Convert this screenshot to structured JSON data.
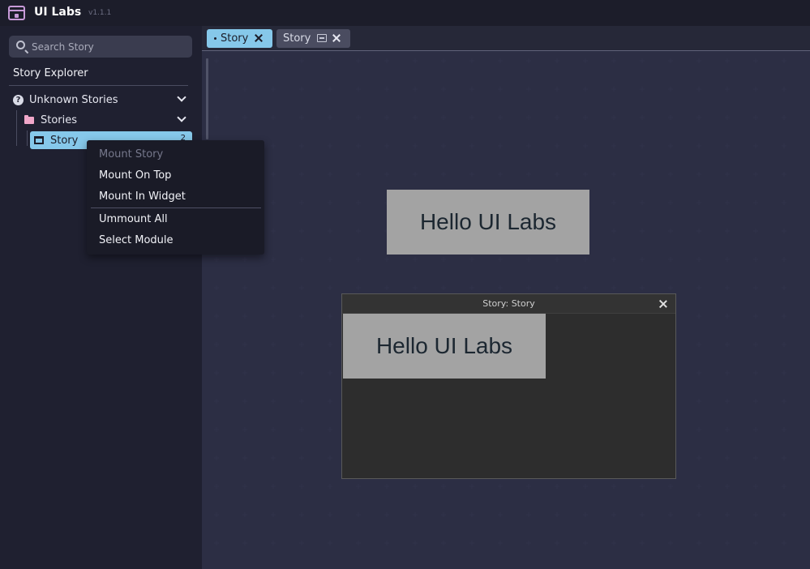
{
  "app": {
    "title": "UI Labs",
    "version": "v1.1.1",
    "logo_icon": "window-app-icon"
  },
  "search": {
    "placeholder": "Search Story",
    "value": ""
  },
  "explorer": {
    "title": "Story Explorer",
    "groups": [
      {
        "label": "Unknown Stories",
        "icon": "help-circle-icon",
        "folders": [
          {
            "label": "Stories",
            "icon": "folder-icon",
            "items": [
              {
                "label": "Story",
                "icon": "story-icon",
                "badge": "2",
                "selected": true
              }
            ]
          }
        ]
      }
    ]
  },
  "tabs": [
    {
      "label": "Story",
      "active": true,
      "modified_dot": true
    },
    {
      "label": "Story",
      "active": false,
      "widget_icon": "widget-window-icon"
    }
  ],
  "canvas": {
    "hello_text": "Hello UI Labs"
  },
  "widget_window": {
    "title": "Story: Story",
    "hello_text": "Hello UI Labs"
  },
  "context_menu": {
    "items": [
      {
        "label": "Mount Story",
        "disabled": true
      },
      {
        "label": "Mount On Top",
        "disabled": false
      },
      {
        "label": "Mount In Widget",
        "disabled": false
      },
      {
        "label": "Ummount All",
        "disabled": false
      },
      {
        "label": "Select Module",
        "disabled": false
      }
    ]
  },
  "colors": {
    "accent": "#86c8ea",
    "background": "#20212f",
    "folder": "#f0a7c9",
    "logo": "#c79ad8"
  }
}
